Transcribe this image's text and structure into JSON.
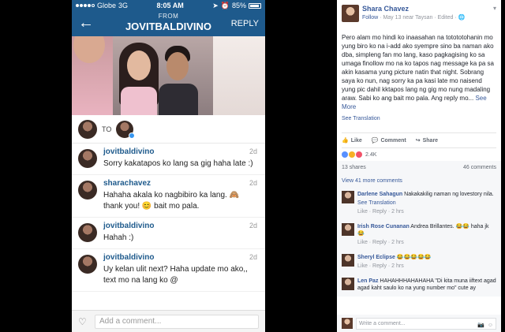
{
  "status_bar": {
    "carrier": "Globe",
    "network": "3G",
    "time": "8:05 AM",
    "battery": "85%",
    "location_icon": "location-arrow-icon",
    "alarm_icon": "alarm-icon"
  },
  "nav": {
    "from_label": "FROM",
    "title": "JOVITBALDIVINO",
    "reply_label": "REPLY",
    "back_icon": "back-arrow-icon"
  },
  "to_label": "TO",
  "messages": [
    {
      "user": "jovitbaldivino",
      "time": "2d",
      "text": "Sorry kakatapos ko lang sa gig haha late :)"
    },
    {
      "user": "sharachavez",
      "time": "2d",
      "text": "Hahaha akala ko nagbibiro ka lang. 🙈 thank you! 😊 bait mo pala."
    },
    {
      "user": "jovitbaldivino",
      "time": "2d",
      "text": "Hahah :)"
    },
    {
      "user": "jovitbaldivino",
      "time": "2d",
      "text": "Uy kelan ulit next? Haha update mo ako,, text mo na lang ko @"
    }
  ],
  "comment_bar": {
    "placeholder": "Add a comment...",
    "heart_icon": "heart-icon"
  },
  "fb": {
    "name": "Shara Chavez",
    "follow": "Follow",
    "meta": " · May 13 near Taysan · Edited · ",
    "body": "Pero alam mo hindi ko inaasahan na totototohanin mo yung biro ko na i-add ako syempre sino ba naman ako dba, simpleng fan mo lang, kaso pagkagising ko sa umaga finollow mo na ko tapos nag message ka pa sa akin kasama yung picture natin that night. Sobrang saya ko nun, nag sorry ka pa kasi late mo naisend yung pic dahil kktapos lang ng gig mo nung madaling araw. Sabi ko ang bait mo pala. Ang reply mo... ",
    "see_more": "See More",
    "see_translation": "See Translation",
    "actions": {
      "like": "Like",
      "comment": "Comment",
      "share": "Share"
    },
    "reactions_count": "2.4K",
    "shares": "13 shares",
    "comments_count": "46 comments",
    "view_more": "View 41 more comments",
    "comments": [
      {
        "name": "Darlene Sahagun",
        "text": "Nakakakilig naman ng lovestory nila.",
        "extra": "See Translation",
        "meta": "Like · Reply · 2 hrs"
      },
      {
        "name": "Irish Rose Cunanan",
        "text": "Andrea Brillantes. 😂😂 haha jk 😂",
        "extra": "",
        "meta": "Like · Reply · 2 hrs"
      },
      {
        "name": "Sheryl Eclipse",
        "text": "😂😂😂😂😂",
        "extra": "",
        "meta": "Like · Reply · 2 hrs"
      },
      {
        "name": "Len Paz",
        "text": "HAHAHHHAHAHAHA \"Di kita muna iiftext agad agad kaht saulo ko na yung number mo\" cute ay",
        "extra": "",
        "meta": ""
      }
    ],
    "write_placeholder": "Write a comment...",
    "camera_icon": "camera-icon",
    "emoji_icon": "emoji-icon"
  }
}
